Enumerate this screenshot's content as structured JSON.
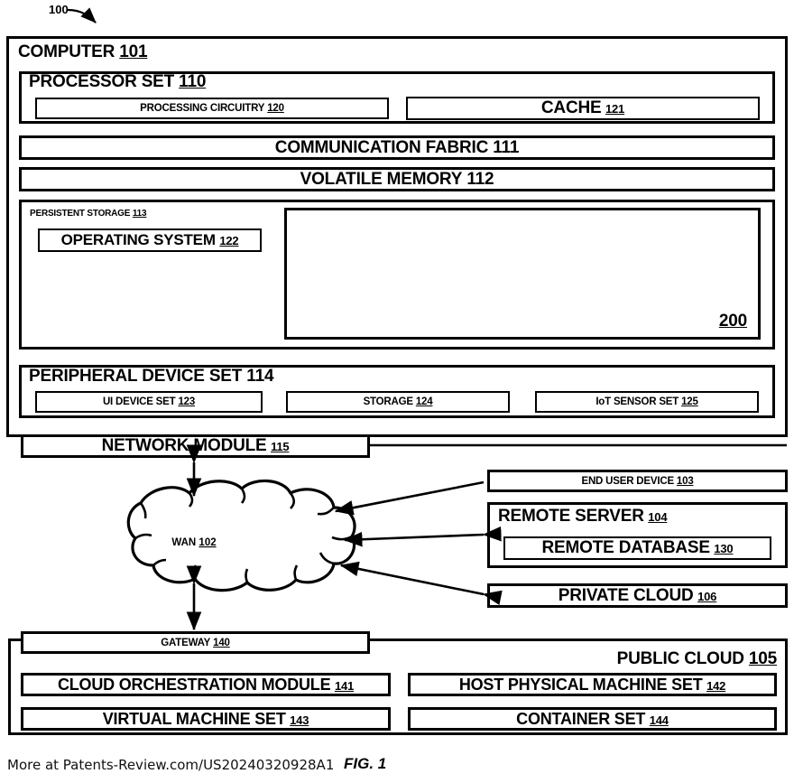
{
  "figure": {
    "reference_numeral": "100",
    "fig_label": "FIG. 1",
    "footer": "More at Patents-Review.com/US20240320928A1"
  },
  "computer": {
    "label": "COMPUTER",
    "num": "101",
    "processor_set": {
      "label": "PROCESSOR SET",
      "num": "110",
      "processing_circuitry": {
        "label": "PROCESSING CIRCUITRY",
        "num": "120"
      },
      "cache": {
        "label": "CACHE",
        "num": "121"
      }
    },
    "communication_fabric": {
      "label": "COMMUNICATION FABRIC",
      "num": "111"
    },
    "volatile_memory": {
      "label": "VOLATILE MEMORY",
      "num": "112"
    },
    "persistent_storage": {
      "label": "PERSISTENT STORAGE",
      "num": "113",
      "operating_system": {
        "label": "OPERATING SYSTEM",
        "num": "122"
      },
      "block_200": {
        "label": "",
        "num": "200"
      }
    },
    "peripheral_device_set": {
      "label": "PERIPHERAL DEVICE SET",
      "num": "114",
      "ui_device_set": {
        "label": "UI DEVICE SET",
        "num": "123"
      },
      "storage": {
        "label": "STORAGE",
        "num": "124"
      },
      "iot_sensor_set": {
        "label": "IoT SENSOR SET",
        "num": "125"
      }
    },
    "network_module": {
      "label": "NETWORK MODULE",
      "num": "115"
    }
  },
  "wan": {
    "label": "WAN",
    "num": "102"
  },
  "end_user_device": {
    "label": "END USER DEVICE",
    "num": "103"
  },
  "remote_server": {
    "label": "REMOTE SERVER",
    "num": "104",
    "remote_database": {
      "label": "REMOTE DATABASE",
      "num": "130"
    }
  },
  "private_cloud": {
    "label": "PRIVATE CLOUD",
    "num": "106"
  },
  "public_cloud": {
    "label": "PUBLIC CLOUD",
    "num": "105",
    "gateway": {
      "label": "GATEWAY",
      "num": "140"
    },
    "cloud_orchestration_module": {
      "label": "CLOUD ORCHESTRATION MODULE",
      "num": "141"
    },
    "host_physical_machine_set": {
      "label": "HOST PHYSICAL MACHINE SET",
      "num": "142"
    },
    "virtual_machine_set": {
      "label": "VIRTUAL MACHINE SET",
      "num": "143"
    },
    "container_set": {
      "label": "CONTAINER SET",
      "num": "144"
    }
  }
}
